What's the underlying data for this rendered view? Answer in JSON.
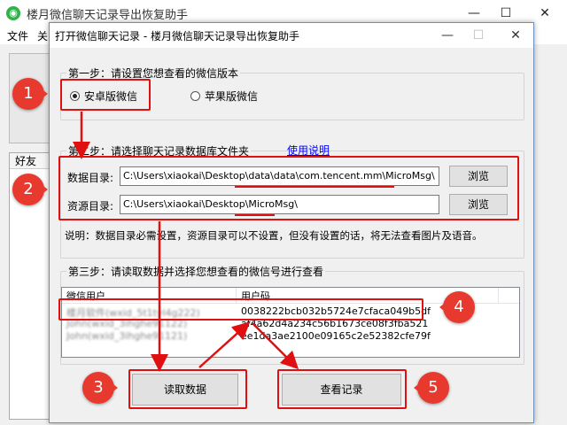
{
  "main_window": {
    "title": "楼月微信聊天记录导出恢复助手",
    "menu": [
      "文件",
      "关"
    ],
    "friends_header": "好友",
    "minimize": "—",
    "maximize": "☐",
    "close": "✕"
  },
  "dialog": {
    "title": "打开微信聊天记录 - 楼月微信聊天记录导出恢复助手",
    "minimize": "—",
    "maximize": "☐",
    "close": "✕",
    "step1": {
      "label": "第一步：请设置您想查看的微信版本",
      "option_android": "安卓版微信",
      "option_ios": "苹果版微信",
      "selected": "android"
    },
    "step2": {
      "label": "第二步：请选择聊天记录数据库文件夹",
      "help_link": "使用说明",
      "data_dir_label": "数据目录:",
      "data_dir_value": "C:\\Users\\xiaokai\\Desktop\\data\\data\\com.tencent.mm\\MicroMsg\\",
      "res_dir_label": "资源目录:",
      "res_dir_value": "C:\\Users\\xiaokai\\Desktop\\MicroMsg\\",
      "browse": "浏览",
      "note": "说明：数据目录必需设置，资源目录可以不设置，但没有设置的话，将无法查看图片及语音。"
    },
    "step3": {
      "label": "第三步：请读取数据并选择您想查看的微信号进行查看",
      "columns": [
        "微信用户",
        "用户码"
      ],
      "rows": [
        {
          "user": "楼月软件(wxid_5t1tyl4g222)",
          "code": "0038222bcb032b5724e7cfaca049b5df"
        },
        {
          "user": "John(wxid_3ihghe91122)",
          "code": "af4a62d4a234c56b1673ce08f3fba521"
        },
        {
          "user": "John(wxid_3ihghe91121)",
          "code": "ee1da3ae2100e09165c2e52382cfe79f"
        }
      ]
    },
    "read_button": "读取数据",
    "view_button": "查看记录"
  },
  "annotations": [
    "1",
    "2",
    "3",
    "4",
    "5"
  ],
  "colors": {
    "accent_red": "#e01010",
    "badge_red": "#e8392f",
    "link_blue": "#0000ff"
  }
}
